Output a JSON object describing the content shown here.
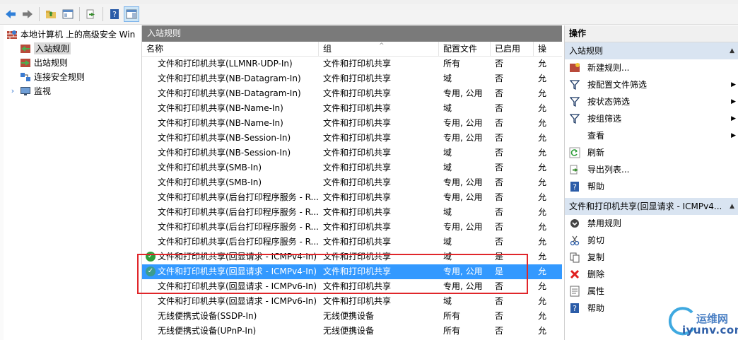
{
  "toolbar": {
    "buttons": [
      "back-icon",
      "forward-icon",
      "up-folder-icon",
      "properties-pane-icon",
      "export-icon",
      "help-icon",
      "show-hide-pane-icon"
    ]
  },
  "tree": {
    "root": "本地计算机 上的高级安全 Win",
    "items": [
      {
        "label": "入站规则",
        "selected": true
      },
      {
        "label": "出站规则",
        "selected": false
      },
      {
        "label": "连接安全规则",
        "selected": false
      },
      {
        "label": "监视",
        "selected": false
      }
    ]
  },
  "center": {
    "title": "入站规则",
    "columns": {
      "name": "名称",
      "group": "组",
      "profile": "配置文件",
      "enabled": "已启用",
      "action": "操"
    },
    "rows": [
      {
        "name": "文件和打印机共享(LLMNR-UDP-In)",
        "group": "文件和打印机共享",
        "profile": "所有",
        "enabled": "否",
        "action": "允",
        "status": false,
        "selected": false
      },
      {
        "name": "文件和打印机共享(NB-Datagram-In)",
        "group": "文件和打印机共享",
        "profile": "域",
        "enabled": "否",
        "action": "允",
        "status": false,
        "selected": false
      },
      {
        "name": "文件和打印机共享(NB-Datagram-In)",
        "group": "文件和打印机共享",
        "profile": "专用, 公用",
        "enabled": "否",
        "action": "允",
        "status": false,
        "selected": false
      },
      {
        "name": "文件和打印机共享(NB-Name-In)",
        "group": "文件和打印机共享",
        "profile": "域",
        "enabled": "否",
        "action": "允",
        "status": false,
        "selected": false
      },
      {
        "name": "文件和打印机共享(NB-Name-In)",
        "group": "文件和打印机共享",
        "profile": "专用, 公用",
        "enabled": "否",
        "action": "允",
        "status": false,
        "selected": false
      },
      {
        "name": "文件和打印机共享(NB-Session-In)",
        "group": "文件和打印机共享",
        "profile": "专用, 公用",
        "enabled": "否",
        "action": "允",
        "status": false,
        "selected": false
      },
      {
        "name": "文件和打印机共享(NB-Session-In)",
        "group": "文件和打印机共享",
        "profile": "域",
        "enabled": "否",
        "action": "允",
        "status": false,
        "selected": false
      },
      {
        "name": "文件和打印机共享(SMB-In)",
        "group": "文件和打印机共享",
        "profile": "域",
        "enabled": "否",
        "action": "允",
        "status": false,
        "selected": false
      },
      {
        "name": "文件和打印机共享(SMB-In)",
        "group": "文件和打印机共享",
        "profile": "专用, 公用",
        "enabled": "否",
        "action": "允",
        "status": false,
        "selected": false
      },
      {
        "name": "文件和打印机共享(后台打印程序服务 - R...",
        "group": "文件和打印机共享",
        "profile": "专用, 公用",
        "enabled": "否",
        "action": "允",
        "status": false,
        "selected": false
      },
      {
        "name": "文件和打印机共享(后台打印程序服务 - R...",
        "group": "文件和打印机共享",
        "profile": "域",
        "enabled": "否",
        "action": "允",
        "status": false,
        "selected": false
      },
      {
        "name": "文件和打印机共享(后台打印程序服务 - R...",
        "group": "文件和打印机共享",
        "profile": "专用, 公用",
        "enabled": "否",
        "action": "允",
        "status": false,
        "selected": false
      },
      {
        "name": "文件和打印机共享(后台打印程序服务 - R...",
        "group": "文件和打印机共享",
        "profile": "域",
        "enabled": "否",
        "action": "允",
        "status": false,
        "selected": false
      },
      {
        "name": "文件和打印机共享(回显请求 - ICMPv4-In)",
        "group": "文件和打印机共享",
        "profile": "域",
        "enabled": "是",
        "action": "允",
        "status": true,
        "selected": false
      },
      {
        "name": "文件和打印机共享(回显请求 - ICMPv4-In)",
        "group": "文件和打印机共享",
        "profile": "专用, 公用",
        "enabled": "是",
        "action": "允",
        "status": true,
        "selected": true
      },
      {
        "name": "文件和打印机共享(回显请求 - ICMPv6-In)",
        "group": "文件和打印机共享",
        "profile": "专用, 公用",
        "enabled": "否",
        "action": "允",
        "status": false,
        "selected": false
      },
      {
        "name": "文件和打印机共享(回显请求 - ICMPv6-In)",
        "group": "文件和打印机共享",
        "profile": "域",
        "enabled": "否",
        "action": "允",
        "status": false,
        "selected": false
      },
      {
        "name": "无线便携式设备(SSDP-In)",
        "group": "无线便携设备",
        "profile": "所有",
        "enabled": "否",
        "action": "允",
        "status": false,
        "selected": false
      },
      {
        "name": "无线便携式设备(UPnP-In)",
        "group": "无线便携设备",
        "profile": "所有",
        "enabled": "否",
        "action": "允",
        "status": false,
        "selected": false
      }
    ]
  },
  "actions": {
    "title": "操作",
    "section1": "入站规则",
    "items1": [
      {
        "label": "新建规则...",
        "icon": "new-rule-icon",
        "arrow": false
      },
      {
        "label": "按配置文件筛选",
        "icon": "filter-icon",
        "arrow": true
      },
      {
        "label": "按状态筛选",
        "icon": "filter-icon",
        "arrow": true
      },
      {
        "label": "按组筛选",
        "icon": "filter-icon",
        "arrow": true
      },
      {
        "label": "查看",
        "icon": "",
        "arrow": true
      },
      {
        "label": "刷新",
        "icon": "refresh-icon",
        "arrow": false
      },
      {
        "label": "导出列表...",
        "icon": "export-icon",
        "arrow": false
      },
      {
        "label": "帮助",
        "icon": "help-icon",
        "arrow": false
      }
    ],
    "section2": "文件和打印机共享(回显请求 - ICMPv4...",
    "items2": [
      {
        "label": "禁用规则",
        "icon": "disable-icon"
      },
      {
        "label": "剪切",
        "icon": "cut-icon"
      },
      {
        "label": "复制",
        "icon": "copy-icon"
      },
      {
        "label": "删除",
        "icon": "delete-icon"
      },
      {
        "label": "属性",
        "icon": "properties-icon"
      },
      {
        "label": "帮助",
        "icon": "help-icon"
      }
    ]
  },
  "watermark": {
    "line1": "运维网",
    "line2": "iyunv.com"
  },
  "colors": {
    "selection": "#3399ff",
    "header": "#7a7a7a",
    "section": "#d9e4f1",
    "highlight_box": "#e0262a",
    "enabled_status": "#2e9e3a"
  }
}
